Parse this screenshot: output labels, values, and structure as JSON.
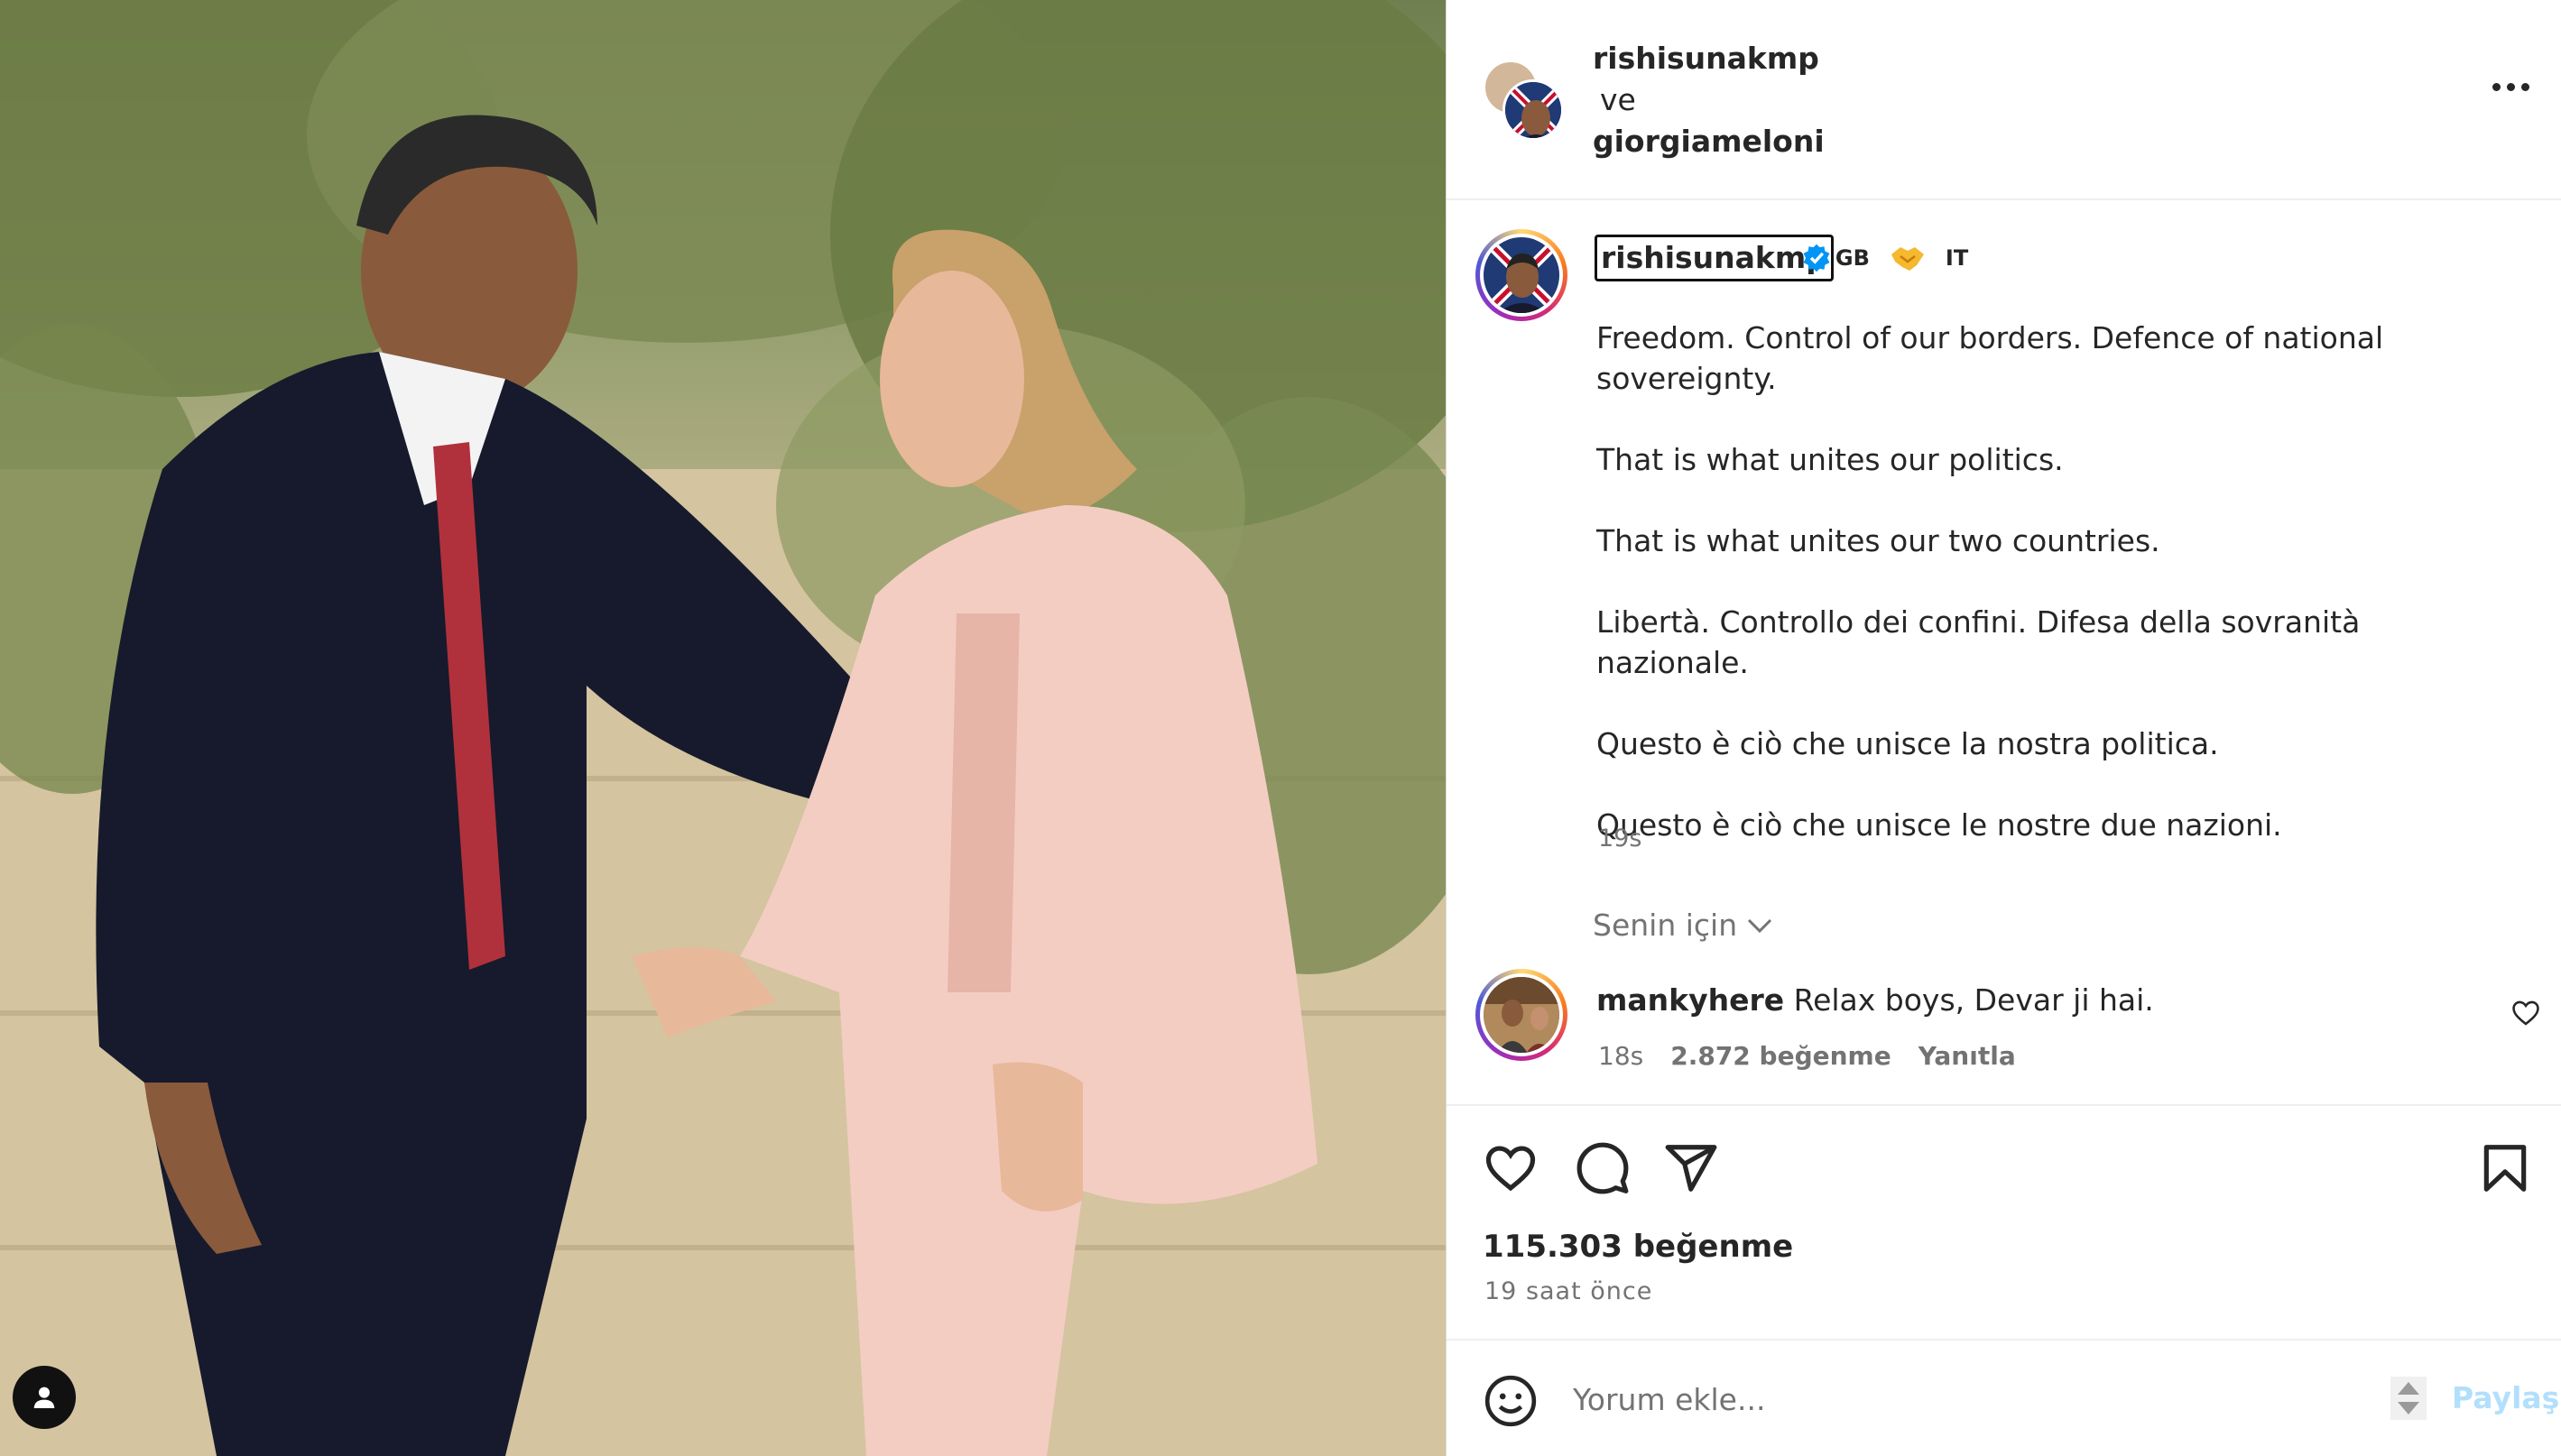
{
  "header": {
    "user1": "rishisunakmp",
    "conjunction": "ve",
    "user2": "giorgiameloni"
  },
  "caption": {
    "username": "rishisunakmp",
    "flag_left": "GB",
    "emoji": "handshake",
    "flag_right": "IT",
    "paragraphs": [
      "Freedom. Control of our borders. Defence of national sovereignty.",
      "That is what unites our politics.",
      "That is what unites our two countries.",
      "Libertà. Controllo dei confini. Difesa della sovranità nazionale.",
      "Questo è ciò che unisce la nostra politica.",
      "Questo è ciò che unisce le nostre due nazioni."
    ],
    "time": "19s"
  },
  "for_you": {
    "label": "Senin için"
  },
  "comment": {
    "username": "mankyhere",
    "text": "Relax boys, Devar ji hai.",
    "time": "18s",
    "likes": "2.872 beğenme",
    "reply": "Yanıtla"
  },
  "post": {
    "likes": "115.303 beğenme",
    "time": "19 saat önce"
  },
  "add_comment": {
    "placeholder": "Yorum ekle...",
    "share": "Paylaş"
  },
  "colors": {
    "accent_disabled": "#b2dffc",
    "verified": "#0095f6",
    "secondary_text": "#737373"
  }
}
